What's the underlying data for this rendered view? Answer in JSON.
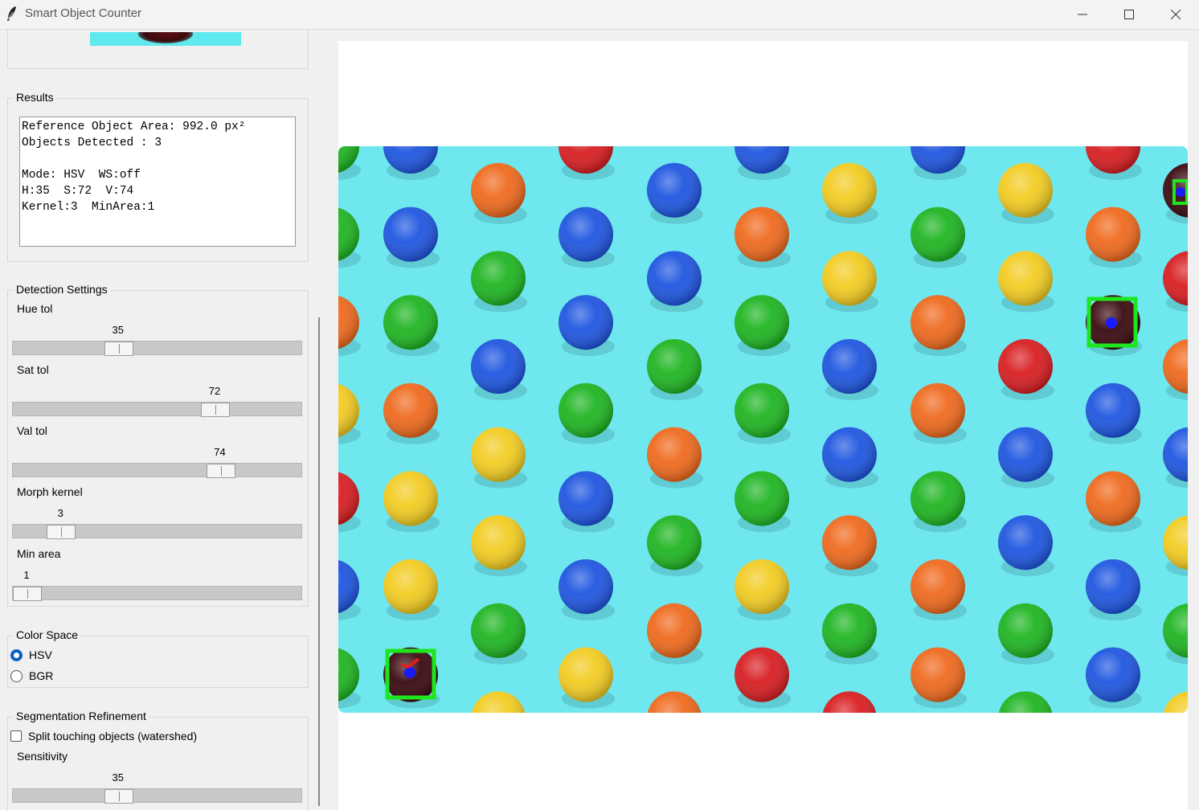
{
  "window": {
    "title": "Smart Object Counter",
    "icon": "feather-icon",
    "controls": [
      "minimize-icon",
      "maximize-icon",
      "close-icon"
    ]
  },
  "results": {
    "title": "Results",
    "lines": [
      "Reference Object Area: 992.0 px²",
      "Objects Detected : 3",
      "",
      "Mode: HSV  WS:off",
      "H:35  S:72  V:74",
      "Kernel:3  MinArea:1"
    ]
  },
  "detection": {
    "title": "Detection Settings",
    "sliders": [
      {
        "label": "Hue tol",
        "value": "35",
        "fraction": 0.35
      },
      {
        "label": "Sat tol",
        "value": "72",
        "fraction": 0.72
      },
      {
        "label": "Val tol",
        "value": "74",
        "fraction": 0.74
      },
      {
        "label": "Morph kernel",
        "value": "3",
        "fraction": 0.13
      },
      {
        "label": "Min area",
        "value": "1",
        "fraction": 0.0
      }
    ]
  },
  "color_space": {
    "title": "Color Space",
    "options": [
      "HSV",
      "BGR"
    ],
    "selected": "HSV"
  },
  "segmentation": {
    "title": "Segmentation Refinement",
    "split_label": "Split touching objects (watershed)",
    "split_checked": false,
    "sensitivity_label": "Sensitivity",
    "sensitivity_value": "35",
    "sensitivity_fraction": 0.35
  },
  "image": {
    "background_color": "#6ee7ef",
    "candy_colors": {
      "red": "#d81e22",
      "orange": "#ef6a1e",
      "yellow": "#f2cc22",
      "green": "#1fb522",
      "blue": "#1f56e0",
      "dark": "#3a0a10"
    },
    "detection_box_color": "#1ee61e",
    "centroid_color": "#1a1aff"
  }
}
